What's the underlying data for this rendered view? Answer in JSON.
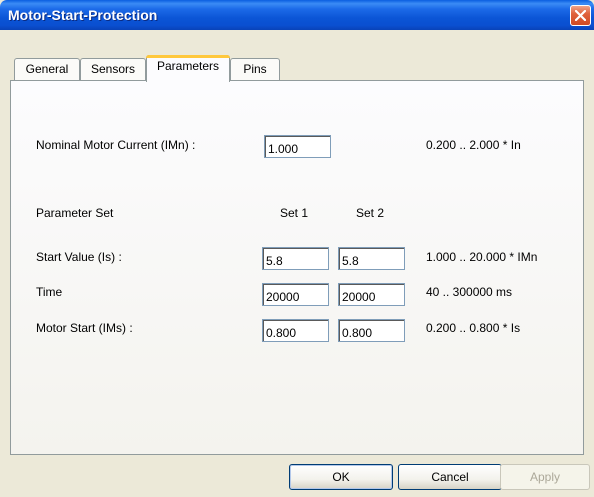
{
  "window": {
    "title": "Motor-Start-Protection"
  },
  "tabs": [
    {
      "label": "General"
    },
    {
      "label": "Sensors"
    },
    {
      "label": "Parameters",
      "active": true
    },
    {
      "label": "Pins"
    }
  ],
  "params": {
    "nominal": {
      "label": "Nominal Motor Current (IMn) :",
      "value": "1.000",
      "range": "0.200 .. 2.000 * In"
    },
    "set_header": {
      "label": "Parameter Set",
      "set1": "Set 1",
      "set2": "Set 2"
    },
    "rows": [
      {
        "label": "Start Value (Is) :",
        "set1": "5.8",
        "set2": "5.8",
        "range": "1.000 .. 20.000 * IMn"
      },
      {
        "label": "Time",
        "set1": "20000",
        "set2": "20000",
        "range": "40 .. 300000 ms"
      },
      {
        "label": "Motor Start (IMs) :",
        "set1": "0.800",
        "set2": "0.800",
        "range": "0.200 .. 0.800 * Is"
      }
    ]
  },
  "buttons": {
    "ok": "OK",
    "cancel": "Cancel",
    "apply": "Apply"
  },
  "colors": {
    "title_bar": "#0a54d8",
    "close_button": "#e0623c",
    "active_tab_highlight": "#ffc83c",
    "dialog_bg": "#ece9d8"
  }
}
